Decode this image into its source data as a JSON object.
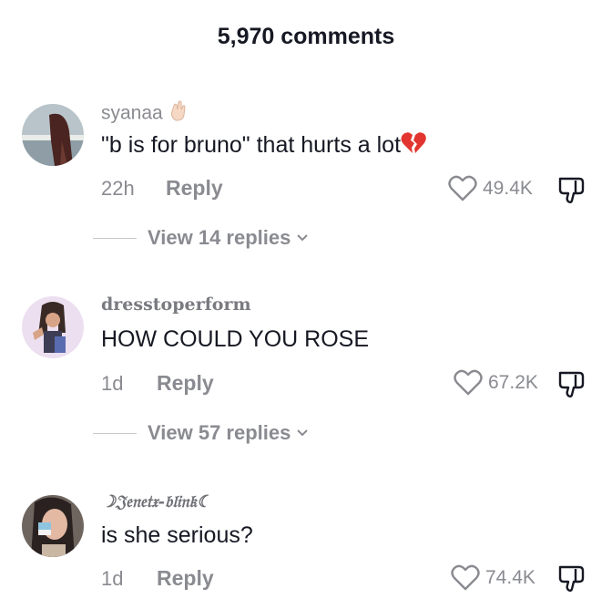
{
  "header": {
    "title": "5,970 comments"
  },
  "comments": [
    {
      "username": "syanaa",
      "username_emoji": "hand-icon",
      "text": "\"b is for bruno\" that hurts a lot",
      "text_emoji": "broken-heart-icon",
      "time": "22h",
      "reply_label": "Reply",
      "likes": "49.4K",
      "view_replies": "View 14 replies"
    },
    {
      "username": "dresstoperform",
      "text": "HOW COULD YOU ROSE",
      "time": "1d",
      "reply_label": "Reply",
      "likes": "67.2K",
      "view_replies": "View 57 replies"
    },
    {
      "username": "☽𝔍𝔢𝔫𝔢𝔱𝔵-𝔟𝔩𝔦𝔫𝔨☾",
      "text": "is she serious?",
      "time": "1d",
      "reply_label": "Reply",
      "likes": "74.4K"
    }
  ],
  "colors": {
    "primary_text": "#161823",
    "secondary_text": "#8a8b91",
    "broken_heart": "#e2352f"
  }
}
